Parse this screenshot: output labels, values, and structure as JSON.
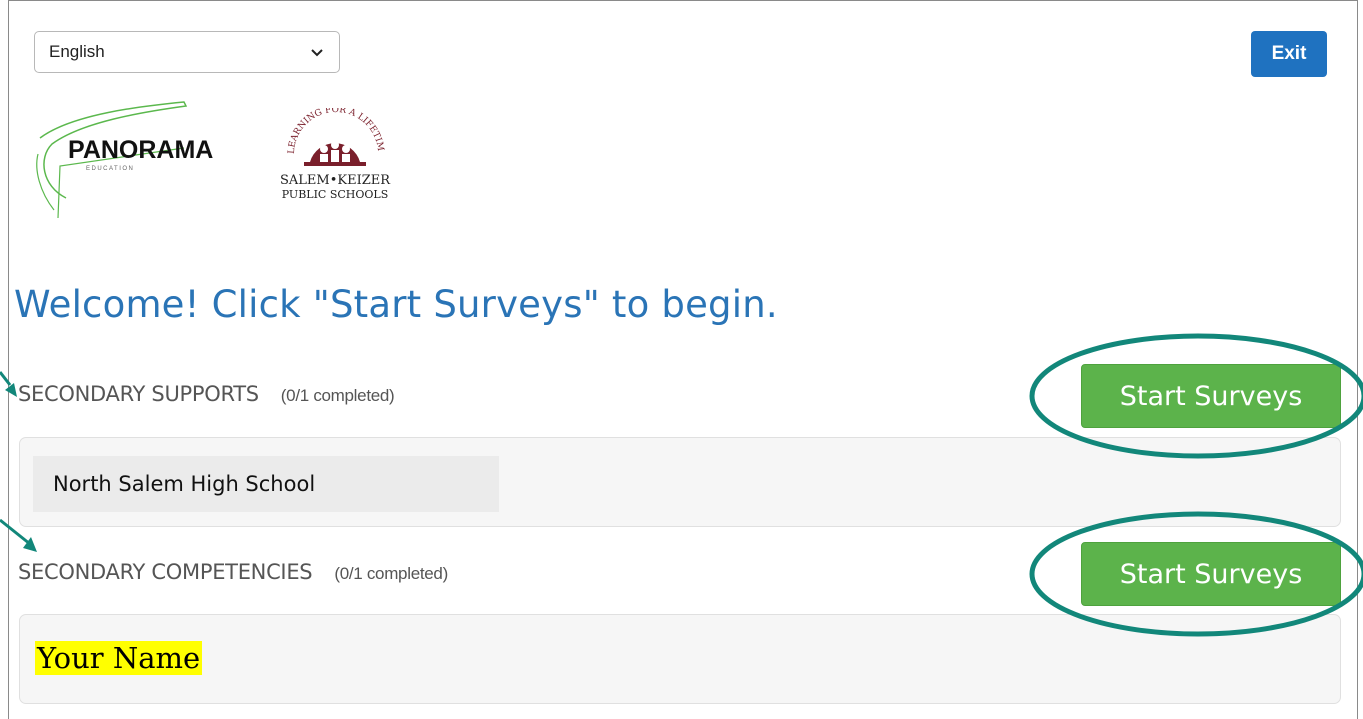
{
  "language": {
    "selected": "English"
  },
  "header": {
    "exit_label": "Exit"
  },
  "logos": {
    "panorama": {
      "text": "PANORAMA",
      "subtext": "EDUCATION"
    },
    "salem": {
      "arc_text": "LEARNING FOR A LIFETIME",
      "line1": "SALEM•KEIZER",
      "line2": "PUBLIC SCHOOLS"
    }
  },
  "welcome": "Welcome! Click \"Start Surveys\" to begin.",
  "sections": [
    {
      "title": "SECONDARY SUPPORTS",
      "count": "(0/1 completed)",
      "button": "Start Surveys",
      "item": "North Salem High School"
    },
    {
      "title": "SECONDARY COMPETENCIES",
      "count": "(0/1 completed)",
      "button": "Start Surveys",
      "item": "Your Name"
    }
  ],
  "colors": {
    "accent_blue": "#1f72c0",
    "welcome_blue": "#2a74b6",
    "button_green": "#5cb34b",
    "annotation_teal": "#12877a",
    "highlight": "#ffff00"
  }
}
